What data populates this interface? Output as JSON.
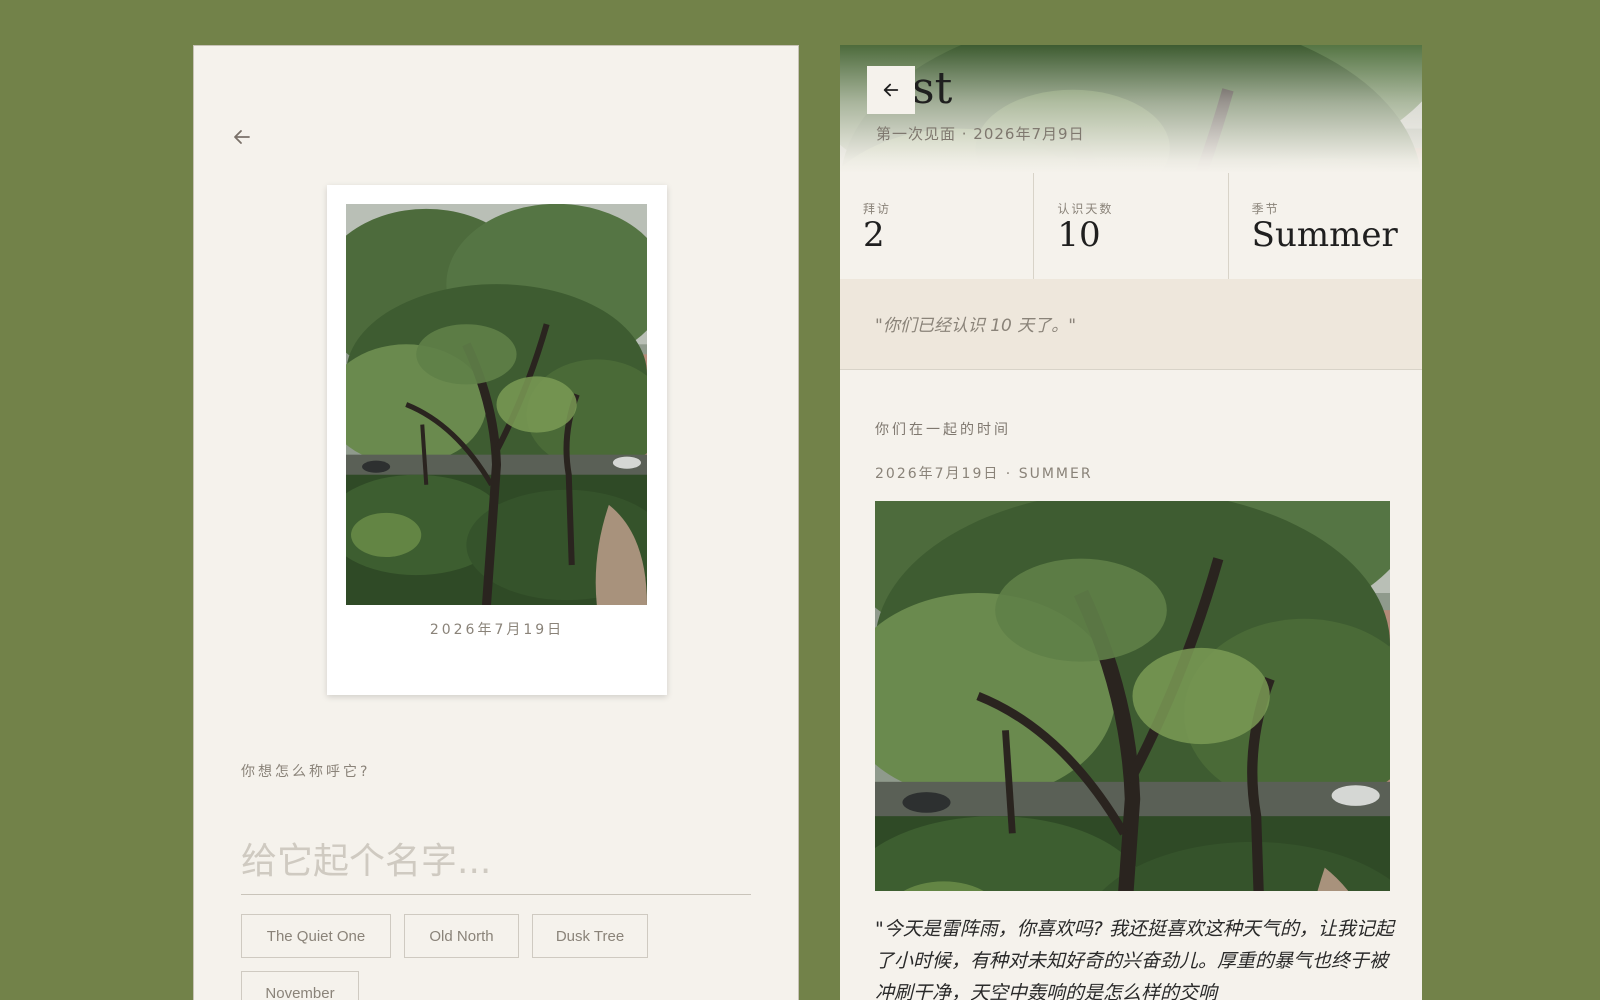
{
  "left": {
    "back_icon": "arrow-left-icon",
    "polaroid_date": "2026年7月19日",
    "name_prompt": "你想怎么称呼它?",
    "name_placeholder": "给它起个名字...",
    "name_value": "",
    "suggestions": [
      "The Quiet One",
      "Old North",
      "Dusk Tree",
      "November"
    ]
  },
  "right": {
    "back_icon": "arrow-left-icon",
    "title_visible": "st",
    "subtitle": "第一次见面 · 2026年7月9日",
    "stats": [
      {
        "label": "拜访",
        "value": "2"
      },
      {
        "label": "认识天数",
        "value": "10"
      },
      {
        "label": "季节",
        "value": "Summer"
      }
    ],
    "quote": "\"你们已经认识 10 天了。\"",
    "section_label": "你们在一起的时间",
    "entry_date": "2026年7月19日 · SUMMER",
    "entry_text": "\"今天是雷阵雨，你喜欢吗? 我还挺喜欢这种天气的，让我记起了小时候，有种对未知好奇的兴奋劲儿。厚重的暴气也终于被冲刷干净，天空中轰响的是怎么样的交响"
  },
  "colors": {
    "background": "#728249",
    "panel": "#f5f2ec",
    "quote_band": "#eee7dc",
    "muted_text": "#8a8379"
  }
}
